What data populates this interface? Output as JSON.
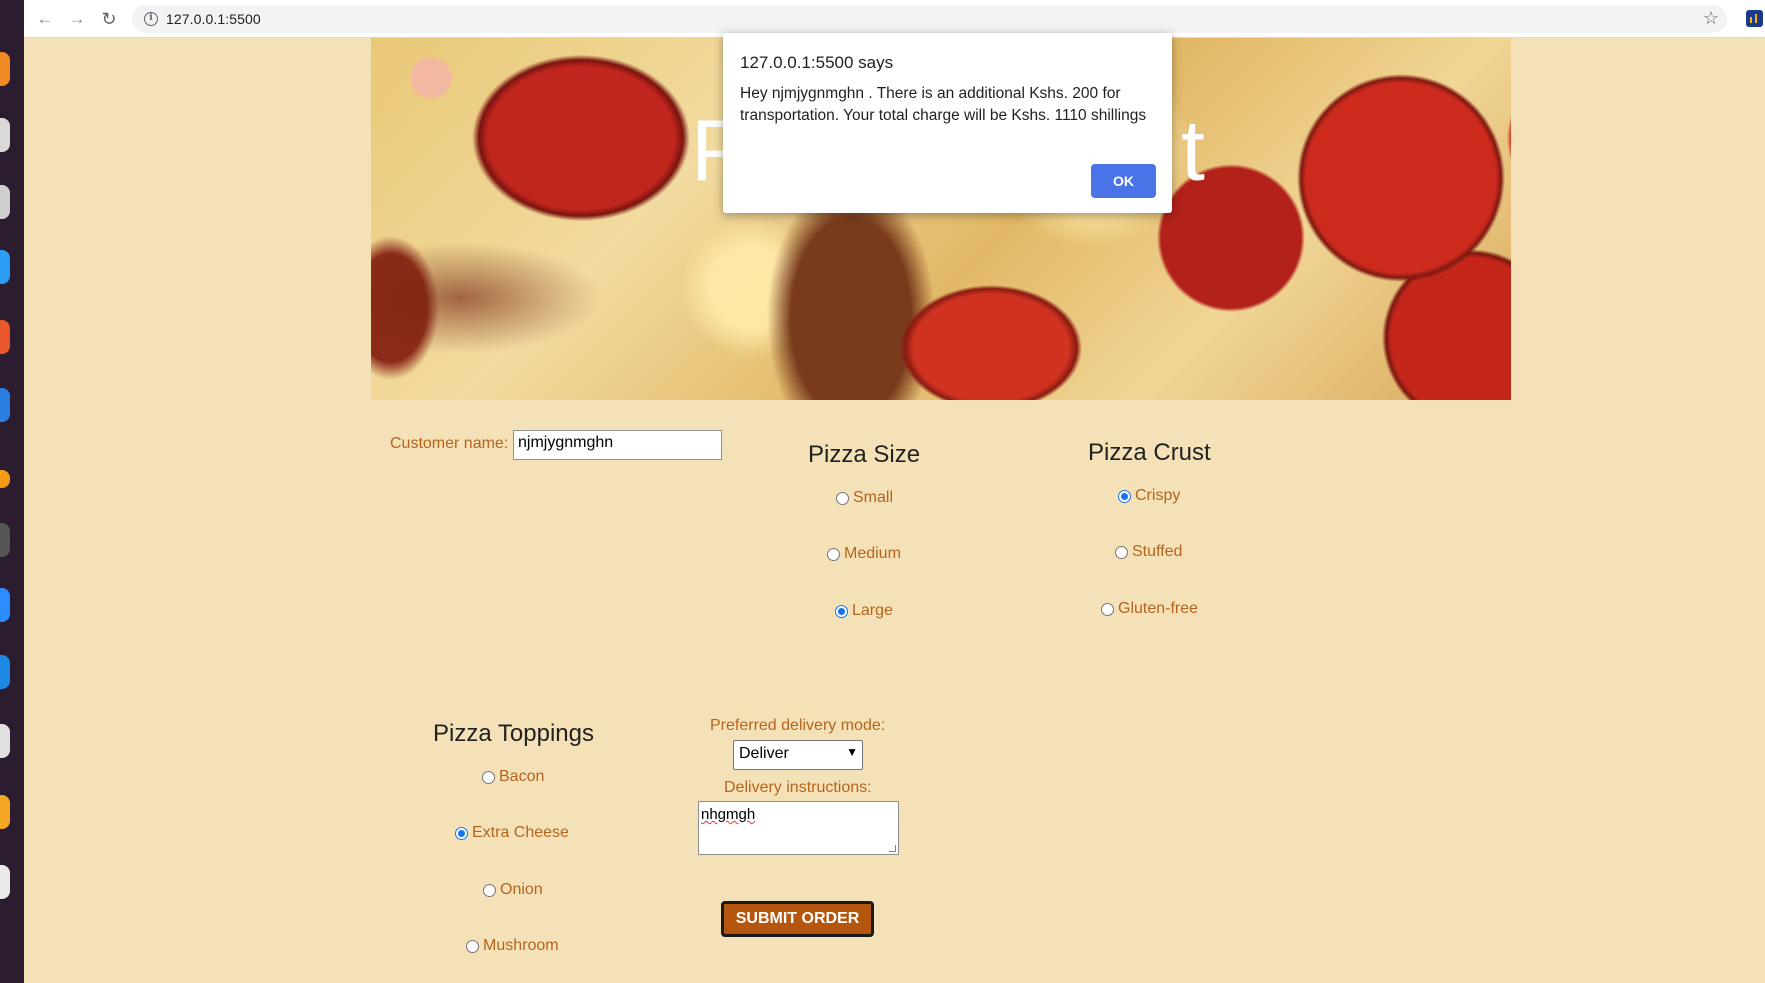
{
  "browser": {
    "url": "127.0.0.1:5500",
    "back_glyph": "←",
    "forward_glyph": "→",
    "reload_glyph": "↻",
    "info_glyph": "i",
    "star_glyph": "☆"
  },
  "hero": {
    "title_start": "P",
    "title_end": "t"
  },
  "form": {
    "customer_label": "Customer name:",
    "customer_value": "njmjygnmghn",
    "size_heading": "Pizza Size",
    "size_options": [
      {
        "label": "Small",
        "checked": false
      },
      {
        "label": "Medium",
        "checked": false
      },
      {
        "label": "Large",
        "checked": true
      }
    ],
    "crust_heading": "Pizza Crust",
    "crust_options": [
      {
        "label": "Crispy",
        "checked": true
      },
      {
        "label": "Stuffed",
        "checked": false
      },
      {
        "label": "Gluten-free",
        "checked": false
      }
    ],
    "toppings_heading": "Pizza Toppings",
    "topping_options": [
      {
        "label": "Bacon",
        "checked": false
      },
      {
        "label": "Extra Cheese",
        "checked": true
      },
      {
        "label": "Onion",
        "checked": false
      },
      {
        "label": "Mushroom",
        "checked": false
      }
    ],
    "delivery_label": "Preferred delivery mode:",
    "delivery_value": "Deliver",
    "instructions_label": "Delivery instructions:",
    "instructions_value": "nhgmgh",
    "submit_label": "SUBMIT ORDER"
  },
  "dialog": {
    "title": "127.0.0.1:5500 says",
    "message": "Hey njmjygnmghn . There is an additional Kshs. 200 for transportation. Your total charge will be Kshs. 1110 shillings",
    "ok_label": "OK"
  },
  "colors": {
    "page_bg": "#f5e1b8",
    "label_brown": "#b5651d",
    "submit_bg": "#b5560f",
    "ok_blue": "#4b73e8",
    "radio_blue": "#1a73e8"
  }
}
